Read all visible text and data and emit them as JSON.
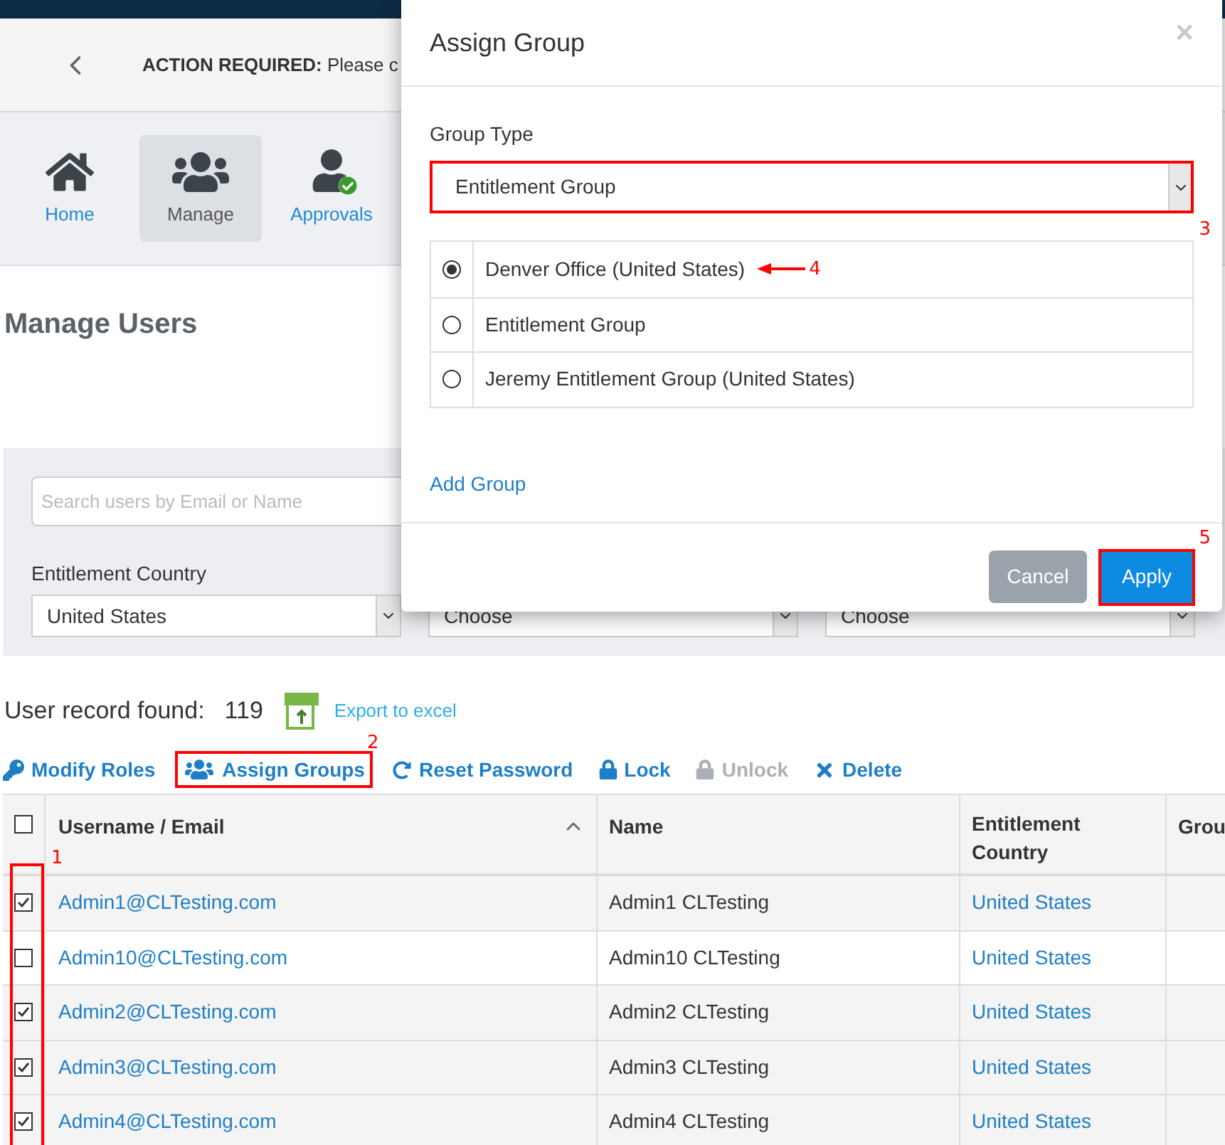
{
  "action_bar": {
    "label": "ACTION REQUIRED:",
    "text": "Please c"
  },
  "nav": [
    {
      "kind": "home",
      "label": "Home",
      "selected": false
    },
    {
      "kind": "manage",
      "label": "Manage",
      "selected": true
    },
    {
      "kind": "approvals",
      "label": "Approvals",
      "selected": false
    }
  ],
  "page_title": "Manage Users",
  "filters": {
    "search": {
      "placeholder": "Search users by Email or Name"
    },
    "country_label": "Entitlement Country",
    "selects": [
      "United States",
      "Choose",
      "Choose"
    ]
  },
  "records": {
    "label": "User record found:",
    "count": "119",
    "export": "Export to excel"
  },
  "toolbar": [
    {
      "kind": "key",
      "label": "Modify Roles",
      "disabled": false
    },
    {
      "kind": "users",
      "label": "Assign Groups",
      "disabled": false
    },
    {
      "kind": "refresh",
      "label": "Reset Password",
      "disabled": false
    },
    {
      "kind": "lock",
      "label": "Lock",
      "disabled": false
    },
    {
      "kind": "unlock",
      "label": "Unlock",
      "disabled": true
    },
    {
      "kind": "delete",
      "label": "Delete",
      "disabled": false
    }
  ],
  "table": {
    "select_all_checked": false,
    "columns": [
      "Username / Email",
      "Name",
      "Entitlement Country",
      "Grou"
    ],
    "rows": [
      {
        "checked": true,
        "email": "Admin1@CLTesting.com",
        "name": "Admin1 CLTesting",
        "country": "United States"
      },
      {
        "checked": false,
        "email": "Admin10@CLTesting.com",
        "name": "Admin10 CLTesting",
        "country": "United States"
      },
      {
        "checked": true,
        "email": "Admin2@CLTesting.com",
        "name": "Admin2 CLTesting",
        "country": "United States"
      },
      {
        "checked": true,
        "email": "Admin3@CLTesting.com",
        "name": "Admin3 CLTesting",
        "country": "United States"
      },
      {
        "checked": true,
        "email": "Admin4@CLTesting.com",
        "name": "Admin4 CLTesting",
        "country": "United States"
      }
    ]
  },
  "dialog": {
    "title": "Assign Group",
    "close": "×",
    "group_type_label": "Group Type",
    "group_type": "Entitlement Group",
    "options": [
      {
        "label": "Denver Office (United States)",
        "selected": true
      },
      {
        "label": "Entitlement Group",
        "selected": false
      },
      {
        "label": "Jeremy Entitlement Group (United States)",
        "selected": false
      }
    ],
    "add_group": "Add Group",
    "cancel": "Cancel",
    "apply": "Apply"
  },
  "annotations": [
    "1",
    "2",
    "3",
    "4",
    "5"
  ]
}
